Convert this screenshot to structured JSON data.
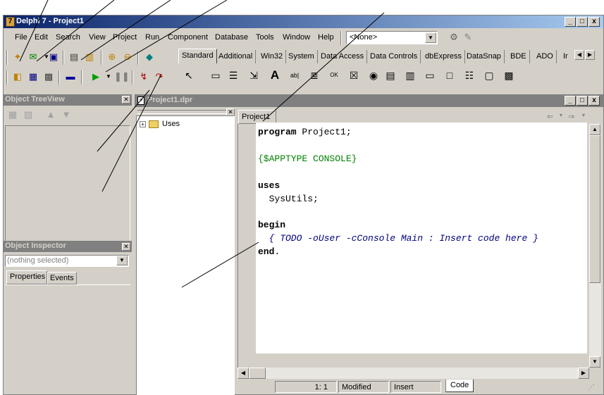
{
  "window": {
    "title": "Delphi 7 - Project1",
    "controls": [
      "_",
      "□",
      "x"
    ]
  },
  "menu": [
    "File",
    "Edit",
    "Search",
    "View",
    "Project",
    "Run",
    "Component",
    "Database",
    "Tools",
    "Window",
    "Help"
  ],
  "config_combo": {
    "value": "<None>"
  },
  "palette_tabs": [
    "Standard",
    "Additional",
    "Win32",
    "System",
    "Data Access",
    "Data Controls",
    "dbExpress",
    "DataSnap",
    "BDE",
    "ADO",
    "Ir"
  ],
  "palette_active_tab": "Standard",
  "treeview": {
    "title": "Object TreeView"
  },
  "inspector": {
    "title": "Object Inspector",
    "selected": "(nothing selected)",
    "tabs": [
      "Properties",
      "Events"
    ]
  },
  "editor": {
    "title": "Project1.dpr",
    "tab": "Project1",
    "explorer_root": "Uses",
    "code_lines": {
      "l1_kw": "program",
      "l1_rest": " Project1;",
      "l2": "{$APPTYPE CONSOLE}",
      "l3_kw": "uses",
      "l4": "  SysUtils;",
      "l5_kw": "begin",
      "l6": "  { TODO -oUser -cConsole Main : Insert code here }",
      "l7_kw": "end",
      "l7_rest": "."
    },
    "status": {
      "position": "1:  1",
      "modified": "Modified",
      "mode": "Insert",
      "view_tab": "Code"
    }
  },
  "colors": {
    "title_start": "#0a246a",
    "title_end": "#a6caf0",
    "directive_green": "#008000",
    "comment_navy": "#000080",
    "face": "#d4d0c8"
  }
}
